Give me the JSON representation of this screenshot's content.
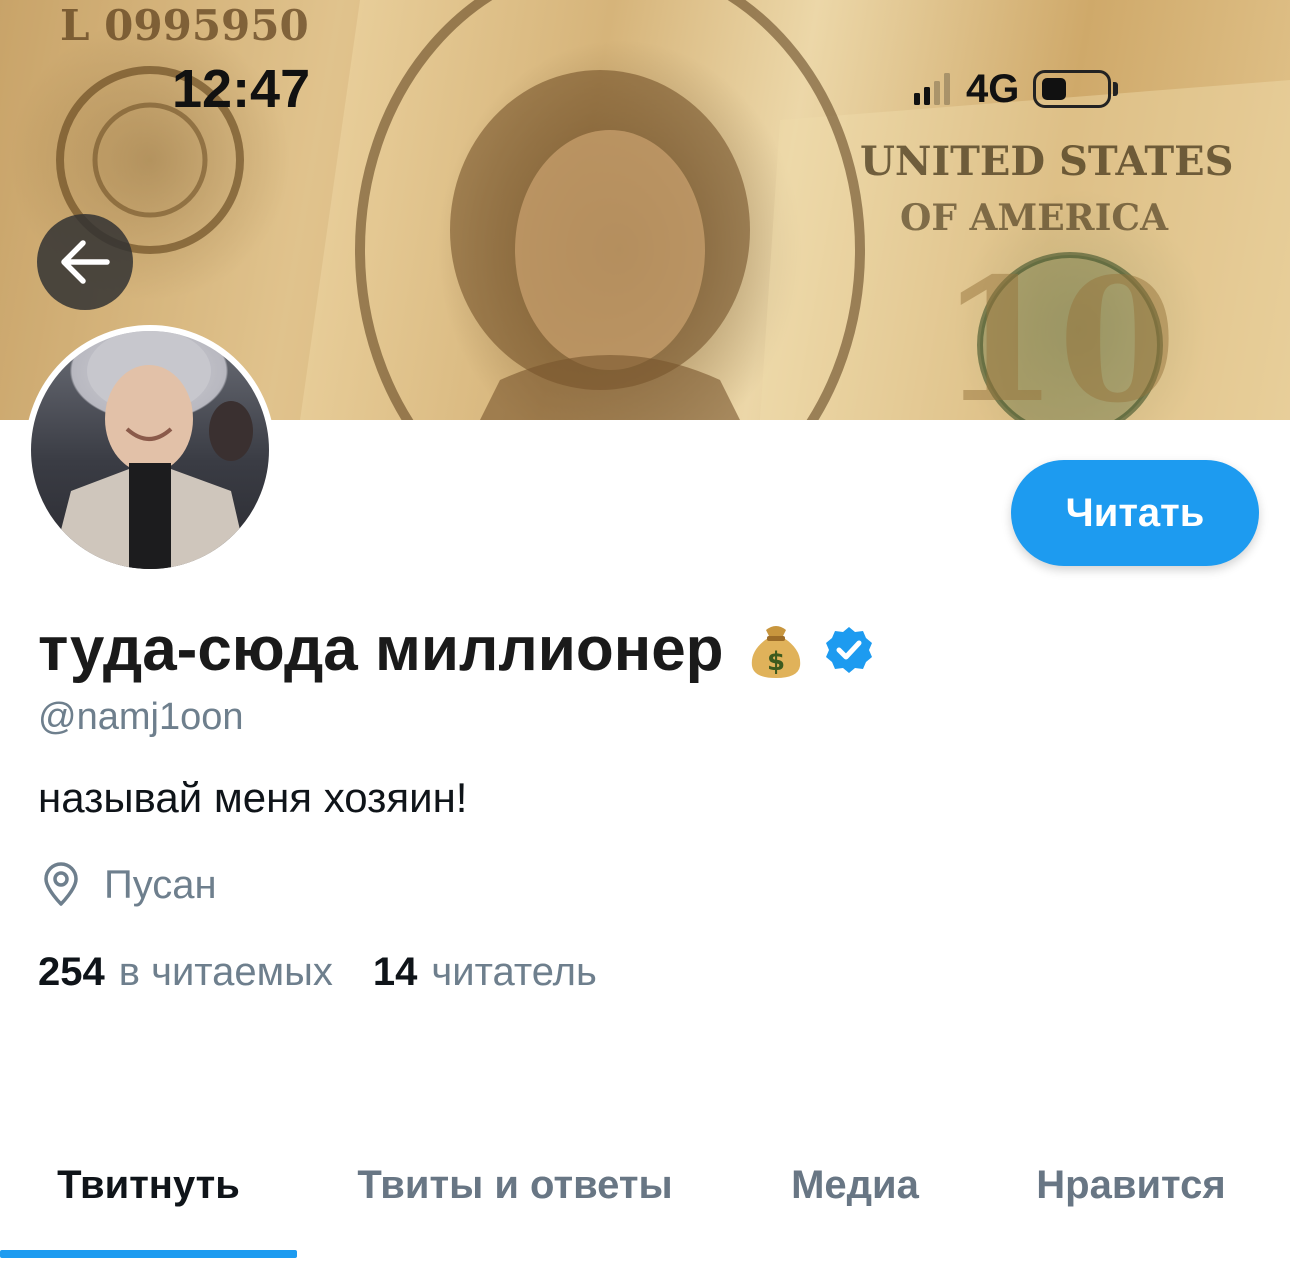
{
  "status_bar": {
    "time": "12:47",
    "network": "4G"
  },
  "header": {
    "back_icon": "arrow-left-icon"
  },
  "profile": {
    "display_name": "туда-сюда миллионер",
    "name_emoji": "💰",
    "verified_icon": "verified-badge-icon",
    "handle": "@namj1oon",
    "bio": "называй меня хозяин!",
    "location_icon": "location-pin-icon",
    "location": "Пусан",
    "following_count": "254",
    "following_label": "в читаемых",
    "followers_count": "14",
    "followers_label": "читатель"
  },
  "actions": {
    "follow_label": "Читать"
  },
  "tabs": [
    {
      "label": "Твитнуть",
      "active": true
    },
    {
      "label": "Твиты и ответы",
      "active": false
    },
    {
      "label": "Медиа",
      "active": false
    },
    {
      "label": "Нравится",
      "active": false
    }
  ],
  "colors": {
    "accent": "#1d9bf0",
    "secondary_text": "#6e7f8d",
    "primary_text": "#0f1419"
  }
}
